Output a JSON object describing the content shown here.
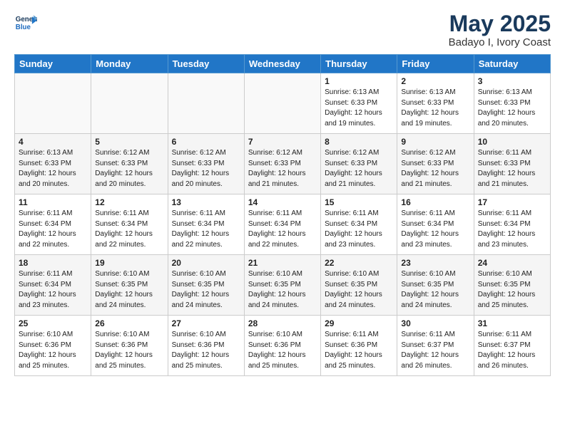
{
  "header": {
    "logo_line1": "General",
    "logo_line2": "Blue",
    "title": "May 2025",
    "subtitle": "Badayo I, Ivory Coast"
  },
  "days_of_week": [
    "Sunday",
    "Monday",
    "Tuesday",
    "Wednesday",
    "Thursday",
    "Friday",
    "Saturday"
  ],
  "weeks": [
    [
      {
        "day": "",
        "info": ""
      },
      {
        "day": "",
        "info": ""
      },
      {
        "day": "",
        "info": ""
      },
      {
        "day": "",
        "info": ""
      },
      {
        "day": "1",
        "info": "Sunrise: 6:13 AM\nSunset: 6:33 PM\nDaylight: 12 hours\nand 19 minutes."
      },
      {
        "day": "2",
        "info": "Sunrise: 6:13 AM\nSunset: 6:33 PM\nDaylight: 12 hours\nand 19 minutes."
      },
      {
        "day": "3",
        "info": "Sunrise: 6:13 AM\nSunset: 6:33 PM\nDaylight: 12 hours\nand 20 minutes."
      }
    ],
    [
      {
        "day": "4",
        "info": "Sunrise: 6:13 AM\nSunset: 6:33 PM\nDaylight: 12 hours\nand 20 minutes."
      },
      {
        "day": "5",
        "info": "Sunrise: 6:12 AM\nSunset: 6:33 PM\nDaylight: 12 hours\nand 20 minutes."
      },
      {
        "day": "6",
        "info": "Sunrise: 6:12 AM\nSunset: 6:33 PM\nDaylight: 12 hours\nand 20 minutes."
      },
      {
        "day": "7",
        "info": "Sunrise: 6:12 AM\nSunset: 6:33 PM\nDaylight: 12 hours\nand 21 minutes."
      },
      {
        "day": "8",
        "info": "Sunrise: 6:12 AM\nSunset: 6:33 PM\nDaylight: 12 hours\nand 21 minutes."
      },
      {
        "day": "9",
        "info": "Sunrise: 6:12 AM\nSunset: 6:33 PM\nDaylight: 12 hours\nand 21 minutes."
      },
      {
        "day": "10",
        "info": "Sunrise: 6:11 AM\nSunset: 6:33 PM\nDaylight: 12 hours\nand 21 minutes."
      }
    ],
    [
      {
        "day": "11",
        "info": "Sunrise: 6:11 AM\nSunset: 6:34 PM\nDaylight: 12 hours\nand 22 minutes."
      },
      {
        "day": "12",
        "info": "Sunrise: 6:11 AM\nSunset: 6:34 PM\nDaylight: 12 hours\nand 22 minutes."
      },
      {
        "day": "13",
        "info": "Sunrise: 6:11 AM\nSunset: 6:34 PM\nDaylight: 12 hours\nand 22 minutes."
      },
      {
        "day": "14",
        "info": "Sunrise: 6:11 AM\nSunset: 6:34 PM\nDaylight: 12 hours\nand 22 minutes."
      },
      {
        "day": "15",
        "info": "Sunrise: 6:11 AM\nSunset: 6:34 PM\nDaylight: 12 hours\nand 23 minutes."
      },
      {
        "day": "16",
        "info": "Sunrise: 6:11 AM\nSunset: 6:34 PM\nDaylight: 12 hours\nand 23 minutes."
      },
      {
        "day": "17",
        "info": "Sunrise: 6:11 AM\nSunset: 6:34 PM\nDaylight: 12 hours\nand 23 minutes."
      }
    ],
    [
      {
        "day": "18",
        "info": "Sunrise: 6:11 AM\nSunset: 6:34 PM\nDaylight: 12 hours\nand 23 minutes."
      },
      {
        "day": "19",
        "info": "Sunrise: 6:10 AM\nSunset: 6:35 PM\nDaylight: 12 hours\nand 24 minutes."
      },
      {
        "day": "20",
        "info": "Sunrise: 6:10 AM\nSunset: 6:35 PM\nDaylight: 12 hours\nand 24 minutes."
      },
      {
        "day": "21",
        "info": "Sunrise: 6:10 AM\nSunset: 6:35 PM\nDaylight: 12 hours\nand 24 minutes."
      },
      {
        "day": "22",
        "info": "Sunrise: 6:10 AM\nSunset: 6:35 PM\nDaylight: 12 hours\nand 24 minutes."
      },
      {
        "day": "23",
        "info": "Sunrise: 6:10 AM\nSunset: 6:35 PM\nDaylight: 12 hours\nand 24 minutes."
      },
      {
        "day": "24",
        "info": "Sunrise: 6:10 AM\nSunset: 6:35 PM\nDaylight: 12 hours\nand 25 minutes."
      }
    ],
    [
      {
        "day": "25",
        "info": "Sunrise: 6:10 AM\nSunset: 6:36 PM\nDaylight: 12 hours\nand 25 minutes."
      },
      {
        "day": "26",
        "info": "Sunrise: 6:10 AM\nSunset: 6:36 PM\nDaylight: 12 hours\nand 25 minutes."
      },
      {
        "day": "27",
        "info": "Sunrise: 6:10 AM\nSunset: 6:36 PM\nDaylight: 12 hours\nand 25 minutes."
      },
      {
        "day": "28",
        "info": "Sunrise: 6:10 AM\nSunset: 6:36 PM\nDaylight: 12 hours\nand 25 minutes."
      },
      {
        "day": "29",
        "info": "Sunrise: 6:11 AM\nSunset: 6:36 PM\nDaylight: 12 hours\nand 25 minutes."
      },
      {
        "day": "30",
        "info": "Sunrise: 6:11 AM\nSunset: 6:37 PM\nDaylight: 12 hours\nand 26 minutes."
      },
      {
        "day": "31",
        "info": "Sunrise: 6:11 AM\nSunset: 6:37 PM\nDaylight: 12 hours\nand 26 minutes."
      }
    ]
  ]
}
